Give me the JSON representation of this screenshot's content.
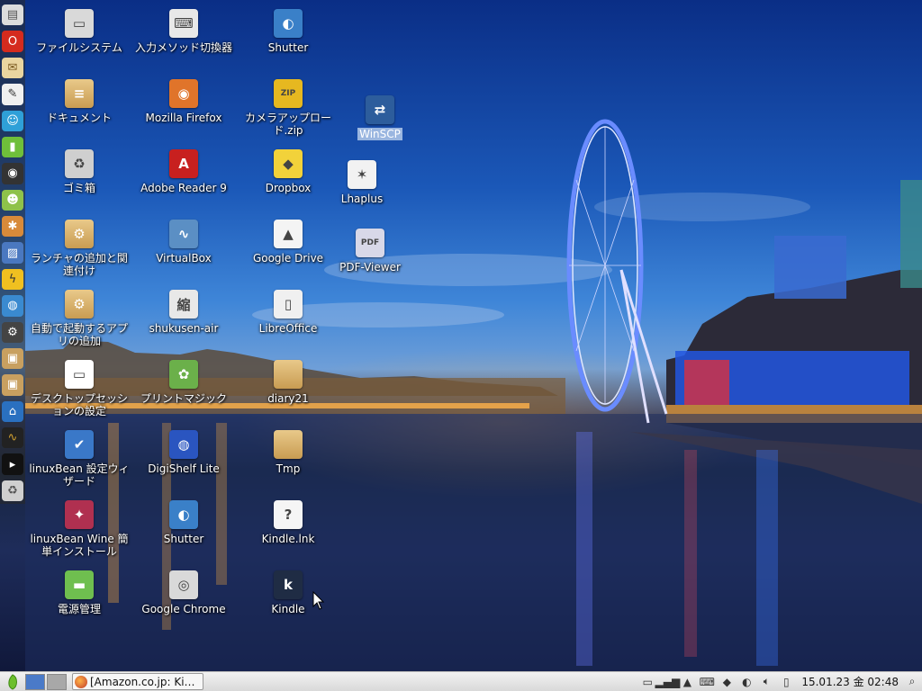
{
  "desktop": {
    "icons": [
      {
        "label": "ファイルシステム",
        "glyph": "▭",
        "bg": "#d9d9d9"
      },
      {
        "label": "ドキュメント",
        "glyph": "≡",
        "bg": "folder"
      },
      {
        "label": "ゴミ箱",
        "glyph": "♻",
        "bg": "#cfcfcf"
      },
      {
        "label": "ランチャの追加と関連付け",
        "glyph": "⚙",
        "bg": "folder"
      },
      {
        "label": "自動で起動するアプリの追加",
        "glyph": "⚙",
        "bg": "folder"
      },
      {
        "label": "デスクトップセッションの設定",
        "glyph": "▭",
        "bg": "#ffffff"
      },
      {
        "label": "linuxBean 設定ウィザード",
        "glyph": "✔",
        "bg": "#3a78c8"
      },
      {
        "label": "linuxBean Wine 簡単インストール",
        "glyph": "✦",
        "bg": "#b03050"
      },
      {
        "label": "電源管理",
        "glyph": "▬",
        "bg": "#6fbf4f"
      },
      {
        "label": "入力メソッド切換器",
        "glyph": "⌨",
        "bg": "#e8e8e8"
      },
      {
        "label": "Mozilla Firefox",
        "glyph": "◉",
        "bg": "#e0742a"
      },
      {
        "label": "Adobe Reader 9",
        "glyph": "A",
        "bg": "#c8201f"
      },
      {
        "label": "VirtualBox",
        "glyph": "∿",
        "bg": "#5b8fc4"
      },
      {
        "label": "shukusen-air",
        "glyph": "縮",
        "bg": "#e8e8e8"
      },
      {
        "label": "プリントマジック",
        "glyph": "✿",
        "bg": "#6bb04a"
      },
      {
        "label": "DigiShelf Lite",
        "glyph": "◍",
        "bg": "#2a55c0"
      },
      {
        "label": "Shutter",
        "glyph": "◐",
        "bg": "#3a80c8"
      },
      {
        "label": "Google Chrome",
        "glyph": "◎",
        "bg": "#d9d9d9"
      },
      {
        "label": "Shutter",
        "glyph": "◐",
        "bg": "#3a80c8"
      },
      {
        "label": "カメラアップロード.zip",
        "glyph": "ZIP",
        "bg": "#e6b820"
      },
      {
        "label": "Dropbox",
        "glyph": "◆",
        "bg": "#f2d23a"
      },
      {
        "label": "Google Drive",
        "glyph": "▲",
        "bg": "#f4f4f4"
      },
      {
        "label": "LibreOffice",
        "glyph": "▯",
        "bg": "#f0f0f0"
      },
      {
        "label": "diary21",
        "glyph": "",
        "bg": "folder"
      },
      {
        "label": "Tmp",
        "glyph": "",
        "bg": "folder"
      },
      {
        "label": "Kindle.lnk",
        "glyph": "?",
        "bg": "#f5f5f5"
      },
      {
        "label": "Kindle",
        "glyph": "k",
        "bg": "#1f2c44"
      },
      {
        "label": "WinSCP",
        "glyph": "⇄",
        "bg": "#2d5d9c"
      },
      {
        "label": "Lhaplus",
        "glyph": "✶",
        "bg": "#f2f2f2"
      },
      {
        "label": "PDF-Viewer",
        "glyph": "PDF",
        "bg": "#d8d8e8"
      }
    ]
  },
  "taskbar": {
    "window_title": "[Amazon.co.jp: Ki…",
    "clock": "15.01.23 金 02:48"
  },
  "colors": {
    "taskbar": "#e6e6e6",
    "selection": "#9ab6e0",
    "dock": "#3a3a3a"
  }
}
